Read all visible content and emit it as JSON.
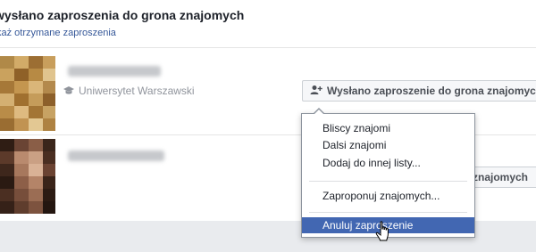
{
  "header": {
    "title": "wysłano zaproszenia do grona znajomych",
    "link": "każ otrzymane zaproszenia"
  },
  "friends": [
    {
      "school": "Uniwersytet Warszawski",
      "request_button": "Wysłano zaproszenie do grona znajomych"
    },
    {
      "request_button": "znajomych"
    }
  ],
  "menu": {
    "items": [
      "Bliscy znajomi",
      "Dalsi znajomi",
      "Dodaj do innej listy...",
      "Zaproponuj znajomych...",
      "Anuluj zaproszenie"
    ],
    "active_item": "Anuluj zaproszenie"
  },
  "colors": {
    "link": "#365899",
    "menu_highlight": "#4267b2",
    "background": "#e9ebee"
  },
  "icons": [
    "graduation-cap-icon",
    "add-friend-icon",
    "hand-cursor-icon"
  ]
}
